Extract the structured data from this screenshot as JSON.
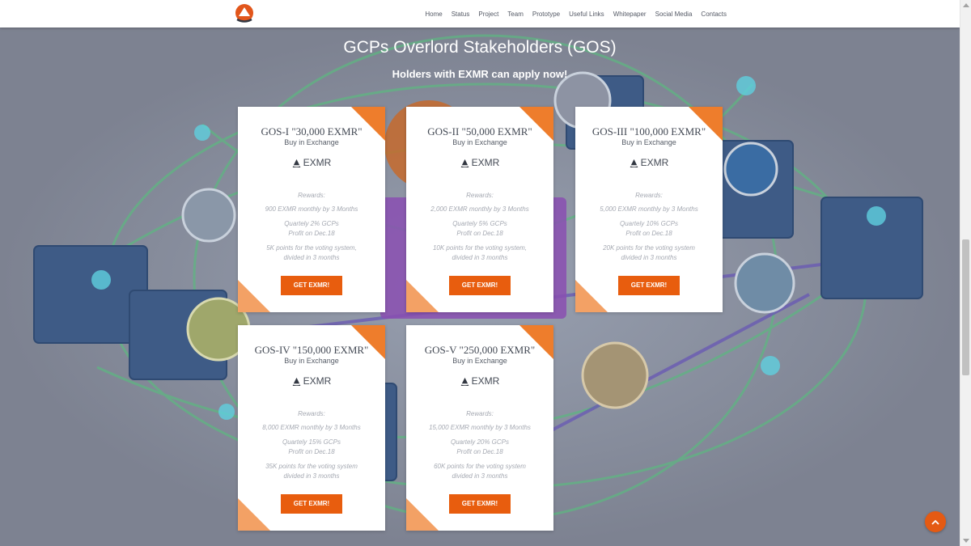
{
  "nav": {
    "items": [
      "Home",
      "Status",
      "Project",
      "Team",
      "Prototype",
      "Useful Links",
      "Whitepaper",
      "Social Media",
      "Contacts"
    ]
  },
  "hero": {
    "title": "GCPs Overlord Stakeholders (GOS)",
    "subtitle": "Holders with EXMR can apply now!"
  },
  "cards": [
    {
      "title": "GOS-I \"30,000 EXMR\"",
      "subtitle": "Buy in Exchange",
      "token": "EXMR",
      "rewards_label": "Rewards:",
      "monthly": "900 EXMR monthly by 3 Months",
      "quarterly": "Quartely 2% GCPs",
      "profit": "Profit on Dec.18",
      "points_1": "5K points for the voting system,",
      "points_2": "divided in 3 months",
      "button": "GET EXMR!"
    },
    {
      "title": "GOS-II \"50,000 EXMR\"",
      "subtitle": "Buy in Exchange",
      "token": "EXMR",
      "rewards_label": "Rewards:",
      "monthly": "2,000 EXMR monthly by 3 Months",
      "quarterly": "Quartely 5% GCPs",
      "profit": "Profit on Dec.18",
      "points_1": "10K points for the voting system,",
      "points_2": "divided in 3 months",
      "button": "GET EXMR!"
    },
    {
      "title": "GOS-III \"100,000 EXMR\"",
      "subtitle": "Buy in Exchange",
      "token": "EXMR",
      "rewards_label": "Rewards:",
      "monthly": "5,000 EXMR monthly by 3 Months",
      "quarterly": "Quartely 10% GCPs",
      "profit": "Profit on Dec.18",
      "points_1": "20K points for the voting system",
      "points_2": "divided in 3 months",
      "button": "GET EXMR!"
    },
    {
      "title": "GOS-IV \"150,000 EXMR\"",
      "subtitle": "Buy in Exchange",
      "token": "EXMR",
      "rewards_label": "Rewards:",
      "monthly": "8,000 EXMR monthly by 3 Months",
      "quarterly": "Quartely 15% GCPs",
      "profit": "Profit on Dec.18",
      "points_1": "35K points for the voting system",
      "points_2": "divided in 3 months",
      "button": "GET EXMR!"
    },
    {
      "title": "GOS-V \"250,000 EXMR\"",
      "subtitle": "Buy in Exchange",
      "token": "EXMR",
      "rewards_label": "Rewards:",
      "monthly": "15,000 EXMR monthly by 3 Months",
      "quarterly": "Quartely 20% GCPs",
      "profit": "Profit on Dec.18",
      "points_1": "60K points for the voting system",
      "points_2": "divided in 3 months",
      "button": "GET EXMR!"
    }
  ],
  "icons": {
    "logo": "exmr-logo-icon",
    "token": "exmr-token-icon",
    "back_to_top": "chevron-up-icon"
  },
  "colors": {
    "accent": "#e85d0e",
    "corner_dark": "#ee7d2c",
    "corner_light": "#f3a165",
    "background": "#7d8291"
  }
}
